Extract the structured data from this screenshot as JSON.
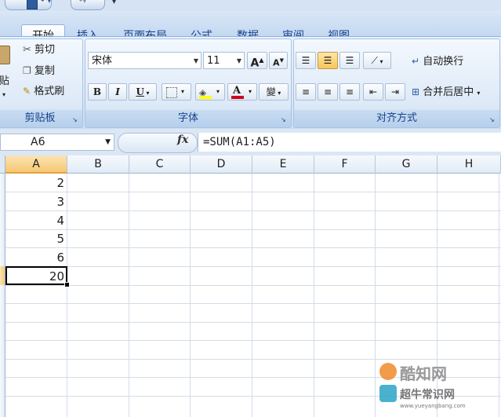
{
  "tabs": [
    "开始",
    "插入",
    "页面布局",
    "公式",
    "数据",
    "审阅",
    "视图"
  ],
  "clipboard": {
    "paste_label": "贴",
    "cut_label": "剪切",
    "copy_label": "复制",
    "format_painter_label": "格式刷",
    "group_label": "剪贴板"
  },
  "font": {
    "font_name": "宋体",
    "font_size": "11",
    "grow_label": "A",
    "shrink_label": "A",
    "bold_label": "B",
    "italic_label": "I",
    "underline_label": "U",
    "font_color_label": "A",
    "phonetic_label": "變",
    "group_label": "字体",
    "font_color": "#d0021b",
    "fill_color": "#ffff00"
  },
  "alignment": {
    "wrap_text_label": "自动换行",
    "merge_center_label": "合并后居中",
    "group_label": "对齐方式"
  },
  "formula_bar": {
    "name_box": "A6",
    "fx_label": "fx",
    "formula": "=SUM(A1:A5)"
  },
  "sheet": {
    "columns": [
      "A",
      "B",
      "C",
      "D",
      "E",
      "F",
      "G",
      "H"
    ],
    "selected_column": "A",
    "active_cell": "A6",
    "cells_A": [
      "2",
      "3",
      "4",
      "5",
      "6",
      "20"
    ]
  },
  "watermark": {
    "brand1": "酷知网",
    "brand2": "超牛常识网",
    "url": "www.yueyangbang.com"
  },
  "colors": {
    "accent": "#15428b",
    "selection_header": "#f7c872"
  }
}
